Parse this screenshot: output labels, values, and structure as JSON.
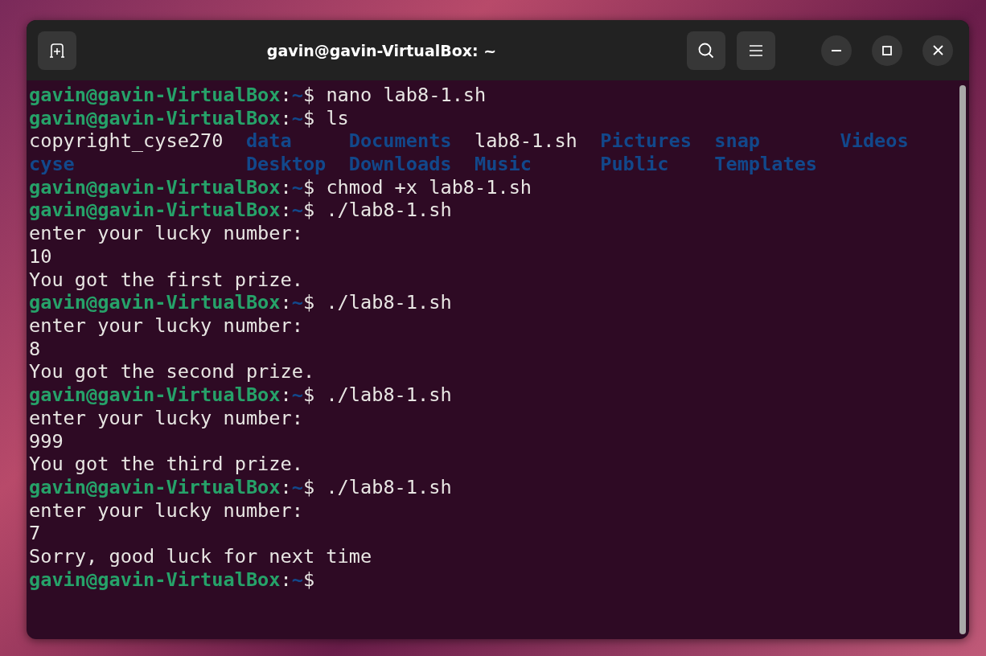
{
  "window": {
    "title": "gavin@gavin-VirtualBox: ~"
  },
  "terminal": {
    "lines": [
      {
        "kind": "prompt",
        "user": "gavin@gavin-VirtualBox",
        "sep": ":",
        "path": "~",
        "symbol": "$",
        "command": "nano lab8-1.sh"
      },
      {
        "kind": "prompt",
        "user": "gavin@gavin-VirtualBox",
        "sep": ":",
        "path": "~",
        "symbol": "$",
        "command": "ls"
      },
      {
        "kind": "listing",
        "columns": [
          [
            {
              "name": "copyright_cyse270",
              "kind": "file"
            },
            {
              "name": "cyse",
              "kind": "dir"
            }
          ],
          [
            {
              "name": "data",
              "kind": "dir"
            },
            {
              "name": "Desktop",
              "kind": "dir"
            }
          ],
          [
            {
              "name": "Documents",
              "kind": "dir"
            },
            {
              "name": "Downloads",
              "kind": "dir"
            }
          ],
          [
            {
              "name": "lab8-1.sh",
              "kind": "file"
            },
            {
              "name": "Music",
              "kind": "dir"
            }
          ],
          [
            {
              "name": "Pictures",
              "kind": "dir"
            },
            {
              "name": "Public",
              "kind": "dir"
            }
          ],
          [
            {
              "name": "snap",
              "kind": "dir"
            },
            {
              "name": "Templates",
              "kind": "dir"
            }
          ],
          [
            {
              "name": "Videos",
              "kind": "dir"
            }
          ]
        ]
      },
      {
        "kind": "prompt",
        "user": "gavin@gavin-VirtualBox",
        "sep": ":",
        "path": "~",
        "symbol": "$",
        "command": "chmod +x lab8-1.sh"
      },
      {
        "kind": "prompt",
        "user": "gavin@gavin-VirtualBox",
        "sep": ":",
        "path": "~",
        "symbol": "$",
        "command": "./lab8-1.sh"
      },
      {
        "kind": "output",
        "text": "enter your lucky number:"
      },
      {
        "kind": "output",
        "text": "10"
      },
      {
        "kind": "output",
        "text": "You got the first prize."
      },
      {
        "kind": "prompt",
        "user": "gavin@gavin-VirtualBox",
        "sep": ":",
        "path": "~",
        "symbol": "$",
        "command": "./lab8-1.sh"
      },
      {
        "kind": "output",
        "text": "enter your lucky number:"
      },
      {
        "kind": "output",
        "text": "8"
      },
      {
        "kind": "output",
        "text": "You got the second prize."
      },
      {
        "kind": "prompt",
        "user": "gavin@gavin-VirtualBox",
        "sep": ":",
        "path": "~",
        "symbol": "$",
        "command": "./lab8-1.sh"
      },
      {
        "kind": "output",
        "text": "enter your lucky number:"
      },
      {
        "kind": "output",
        "text": "999"
      },
      {
        "kind": "output",
        "text": "You got the third prize."
      },
      {
        "kind": "prompt",
        "user": "gavin@gavin-VirtualBox",
        "sep": ":",
        "path": "~",
        "symbol": "$",
        "command": "./lab8-1.sh"
      },
      {
        "kind": "output",
        "text": "enter your lucky number:"
      },
      {
        "kind": "output",
        "text": "7"
      },
      {
        "kind": "output",
        "text": "Sorry, good luck for next time"
      },
      {
        "kind": "prompt",
        "user": "gavin@gavin-VirtualBox",
        "sep": ":",
        "path": "~",
        "symbol": "$"
      }
    ]
  }
}
